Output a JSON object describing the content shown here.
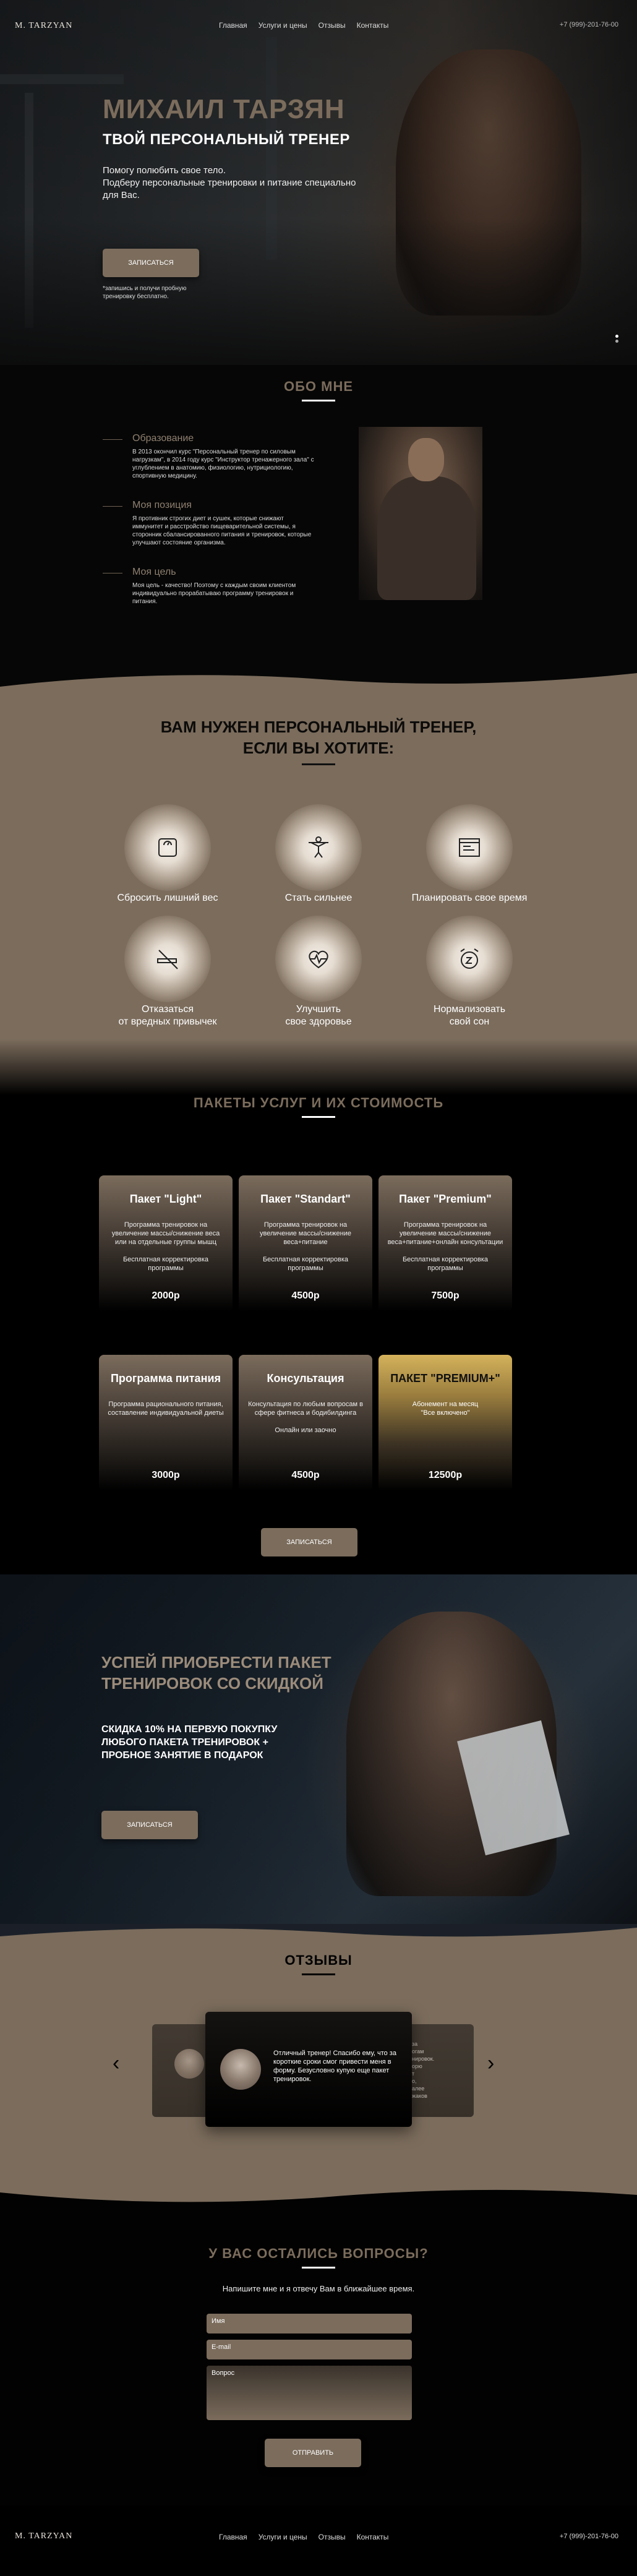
{
  "header": {
    "logo": "M. TARZYAN",
    "nav": [
      "Главная",
      "Услуги и цены",
      "Отзывы",
      "Контакты"
    ],
    "phone": "+7 (999)-201-76-00"
  },
  "hero": {
    "title": "МИХАИЛ ТАРЗЯН",
    "subtitle": "ТВОЙ ПЕРСОНАЛЬНЫЙ ТРЕНЕР",
    "text": "Помогу полюбить свое тело.\nПодберу персональные тренировки и питание специально для Вас.",
    "button": "ЗАПИСАТЬСЯ",
    "note": "*запишись и получи пробную тренировку бесплатно."
  },
  "about": {
    "title": "ОБО МНЕ",
    "items": [
      {
        "heading": "Образование",
        "text": "В 2013 окончил курс \"Персональный тренер по силовым нагрузкам\", в 2014 году курс \"Инструктор тренажерного зала\" с углублением в анатомию, физиологию, нутрициологию, спортивную медицину."
      },
      {
        "heading": "Моя позиция",
        "text": "Я противник строгих диет и сушек, которые снижают иммунитет и расстройство пищеварительной системы, я сторонник сбалансированного питания и тренировок, которые улучшают состояние организма."
      },
      {
        "heading": "Моя цель",
        "text": "Моя цель - качество! Поэтому с каждым своим клиентом индивидуально прорабатываю программу тренировок и питания."
      }
    ]
  },
  "needs": {
    "title_line1": "ВАМ НУЖЕН ПЕРСОНАЛЬНЫЙ ТРЕНЕР,",
    "title_line2": "ЕСЛИ ВЫ ХОТИТЕ:",
    "items": [
      {
        "label": "Сбросить лишний вес",
        "icon": "scale-icon"
      },
      {
        "label": "Стать сильнее",
        "icon": "strength-icon"
      },
      {
        "label": "Планировать свое время",
        "icon": "planner-icon"
      },
      {
        "label": "Отказаться\nот вредных привычек",
        "icon": "no-smoking-icon"
      },
      {
        "label": "Улучшить\nсвое здоровье",
        "icon": "heart-pulse-icon"
      },
      {
        "label": "Нормализовать\nсвой сон",
        "icon": "alarm-clock-icon"
      }
    ]
  },
  "packages": {
    "title": "ПАКЕТЫ УСЛУГ И ИХ СТОИМОСТЬ",
    "cards": [
      {
        "title": "Пакет \"Light\"",
        "desc": "Программа тренировок на увеличение массы/снижение веса или на отдельные группы мышц\n\nБесплатная корректировка программы",
        "price": "2000р"
      },
      {
        "title": "Пакет \"Standart\"",
        "desc": "Программа тренировок на увеличение массы/снижение веса+питание\n\nБесплатная корректировка программы",
        "price": "4500р"
      },
      {
        "title": "Пакет \"Premium\"",
        "desc": "Программа тренировок на увеличение массы/снижение веса+питание+онлайн консультации\n\nБесплатная корректировка программы",
        "price": "7500р"
      },
      {
        "title": "Программа питания",
        "desc": "Программа рационального питания, составление индивидуальной диеты",
        "price": "3000р"
      },
      {
        "title": "Консультация",
        "desc": "Консультация по любым вопросам в сфере фитнеса и бодибилдинга\n\nОнлайн или заочно",
        "price": "4500р"
      },
      {
        "title": "ПАКЕТ \"PREMIUM+\"",
        "desc": "Абонемент на месяц\n\"Все включено\"",
        "price": "12500р",
        "gold": true
      }
    ],
    "button": "ЗАПИСАТЬСЯ"
  },
  "promo": {
    "title_line1": "УСПЕЙ ПРИОБРЕСТИ ПАКЕТ",
    "title_line2": "ТРЕНИРОВОК СО СКИДКОЙ",
    "text_line1": "СКИДКА 10% НА ПЕРВУЮ ПОКУПКУ",
    "text_line2": "ЛЮБОГО ПАКЕТА ТРЕНИРОВОК +",
    "text_line3": "ПРОБНОЕ ЗАНЯТИЕ В ПОДАРОК",
    "button": "ЗАПИСАТЬСЯ"
  },
  "reviews": {
    "title": "ОТЗЫВЫ",
    "main": "Отличный тренер! Спасибо ему, что за короткие сроки смог привести меня в форму. Безусловно купую еще пакет тренировок.",
    "side_right": "за\nогам\nнировок.\nорю\nт\nо,\nалее\nжаков"
  },
  "contact": {
    "title": "У ВАС ОСТАЛИСЬ ВОПРОСЫ?",
    "subtitle": "Напишите мне и я отвечу Вам в ближайшее время.",
    "name_placeholder": "Имя",
    "email_placeholder": "E-mail",
    "question_placeholder": "Вопрос",
    "button": "ОТПРАВИТЬ"
  },
  "footer": {
    "logo": "M. TARZYAN",
    "nav": [
      "Главная",
      "Услуги и цены",
      "Отзывы",
      "Контакты"
    ],
    "phone": "+7 (999)-201-76-00"
  },
  "colors": {
    "accent": "#7b6c5c",
    "gold": "#d4b25b",
    "dark": "#060606"
  }
}
